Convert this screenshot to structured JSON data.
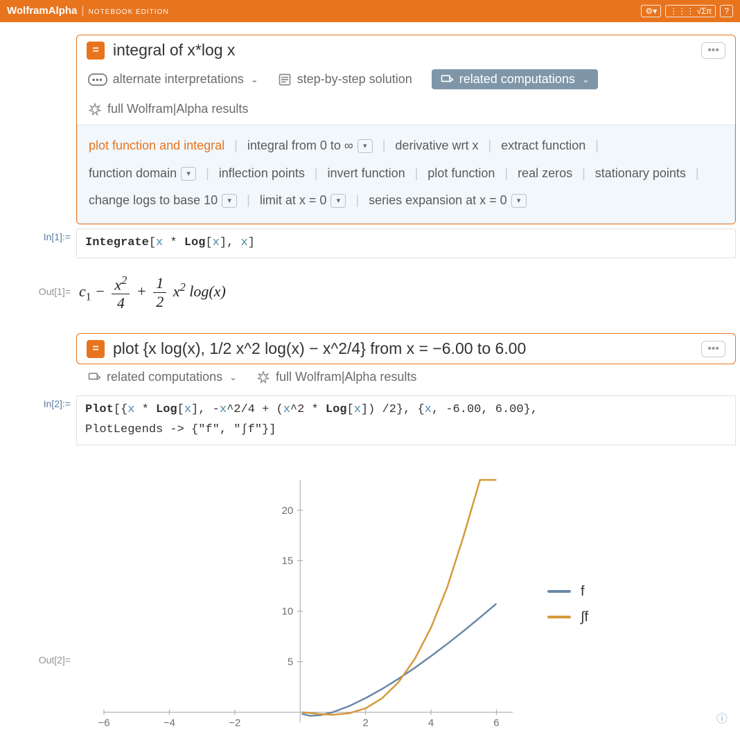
{
  "header": {
    "brand_main": "WolframAlpha",
    "brand_sub": "NOTEBOOK EDITION",
    "toolbar": {
      "settings": "⚙▾",
      "palette": "⋮⋮⋮ √Σπ",
      "help": "?"
    }
  },
  "cell1": {
    "query": "integral of x*log x",
    "in_label": "In[1]:=",
    "out_label": "Out[1]=",
    "actions": {
      "alt": "alternate interpretations",
      "step": "step-by-step solution",
      "related": "related computations",
      "full": "full Wolfram|Alpha results"
    },
    "related": [
      "plot function and integral",
      "integral from 0 to ∞",
      "derivative wrt x",
      "extract function",
      "function domain",
      "inflection points",
      "invert function",
      "plot function",
      "real zeros",
      "stationary points",
      "change logs to base 10",
      "limit at x = 0",
      "series expansion at x = 0"
    ],
    "code": {
      "fn": "Integrate",
      "open": "[",
      "a1": "x",
      "star": " * ",
      "log": "Log",
      "lo": "[",
      "lx": "x",
      "lc": "]",
      "comma": ", ",
      "a2": "x",
      "close": "]"
    },
    "output_latex": "c₁ − x²/4 + (1/2) x² log(x)"
  },
  "cell2": {
    "query": "plot {x log(x), 1/2 x^2 log(x) − x^2/4} from x = −6.00 to 6.00",
    "in_label": "In[2]:=",
    "out_label": "Out[2]=",
    "actions": {
      "related": "related computations",
      "full": "full Wolfram|Alpha results"
    },
    "code_line1a": "Plot",
    "code_line1b": "[{",
    "code_xa": "x",
    "code_star": " * ",
    "code_log": "Log",
    "code_lo": "[",
    "code_lx": "x",
    "code_lc": "], ",
    "code_neg": "-",
    "code_xb": "x",
    "code_pow": "^2/4 + (",
    "code_xc": "x",
    "code_pow2": "^2 * ",
    "code_log2": "Log",
    "code_lo2": "[",
    "code_lx2": "x",
    "code_lc2": "]) /2}, {",
    "code_xd": "x",
    "code_range": ", -6.00, 6.00},",
    "code_line2": " PlotLegends -> {\"f\", \"∫f\"}]"
  },
  "chart_data": {
    "type": "line",
    "xlim": [
      -6,
      6.5
    ],
    "ylim": [
      -1,
      23
    ],
    "xticks": [
      -6,
      -4,
      -2,
      2,
      4,
      6
    ],
    "yticks": [
      5,
      10,
      15,
      20
    ],
    "series": [
      {
        "name": "f",
        "color": "#6a89a8",
        "x": [
          0.05,
          0.3,
          0.6,
          1,
          1.5,
          2,
          2.5,
          3,
          3.5,
          4,
          4.5,
          5,
          5.5,
          6
        ],
        "y": [
          -0.15,
          -0.36,
          -0.31,
          0,
          0.61,
          1.39,
          2.29,
          3.3,
          4.38,
          5.55,
          6.77,
          8.05,
          9.38,
          10.75
        ]
      },
      {
        "name": "∫f",
        "color": "#d59a3a",
        "x": [
          0.05,
          0.3,
          0.6,
          1,
          1.5,
          2,
          2.5,
          3,
          3.5,
          4,
          4.5,
          5,
          5.5,
          6
        ],
        "y": [
          -0.004,
          -0.077,
          -0.182,
          -0.25,
          -0.106,
          0.386,
          1.363,
          2.944,
          5.24,
          8.36,
          12.4,
          17.47,
          23.67,
          23.67
        ]
      }
    ],
    "legend": [
      "f",
      "∫f"
    ]
  }
}
